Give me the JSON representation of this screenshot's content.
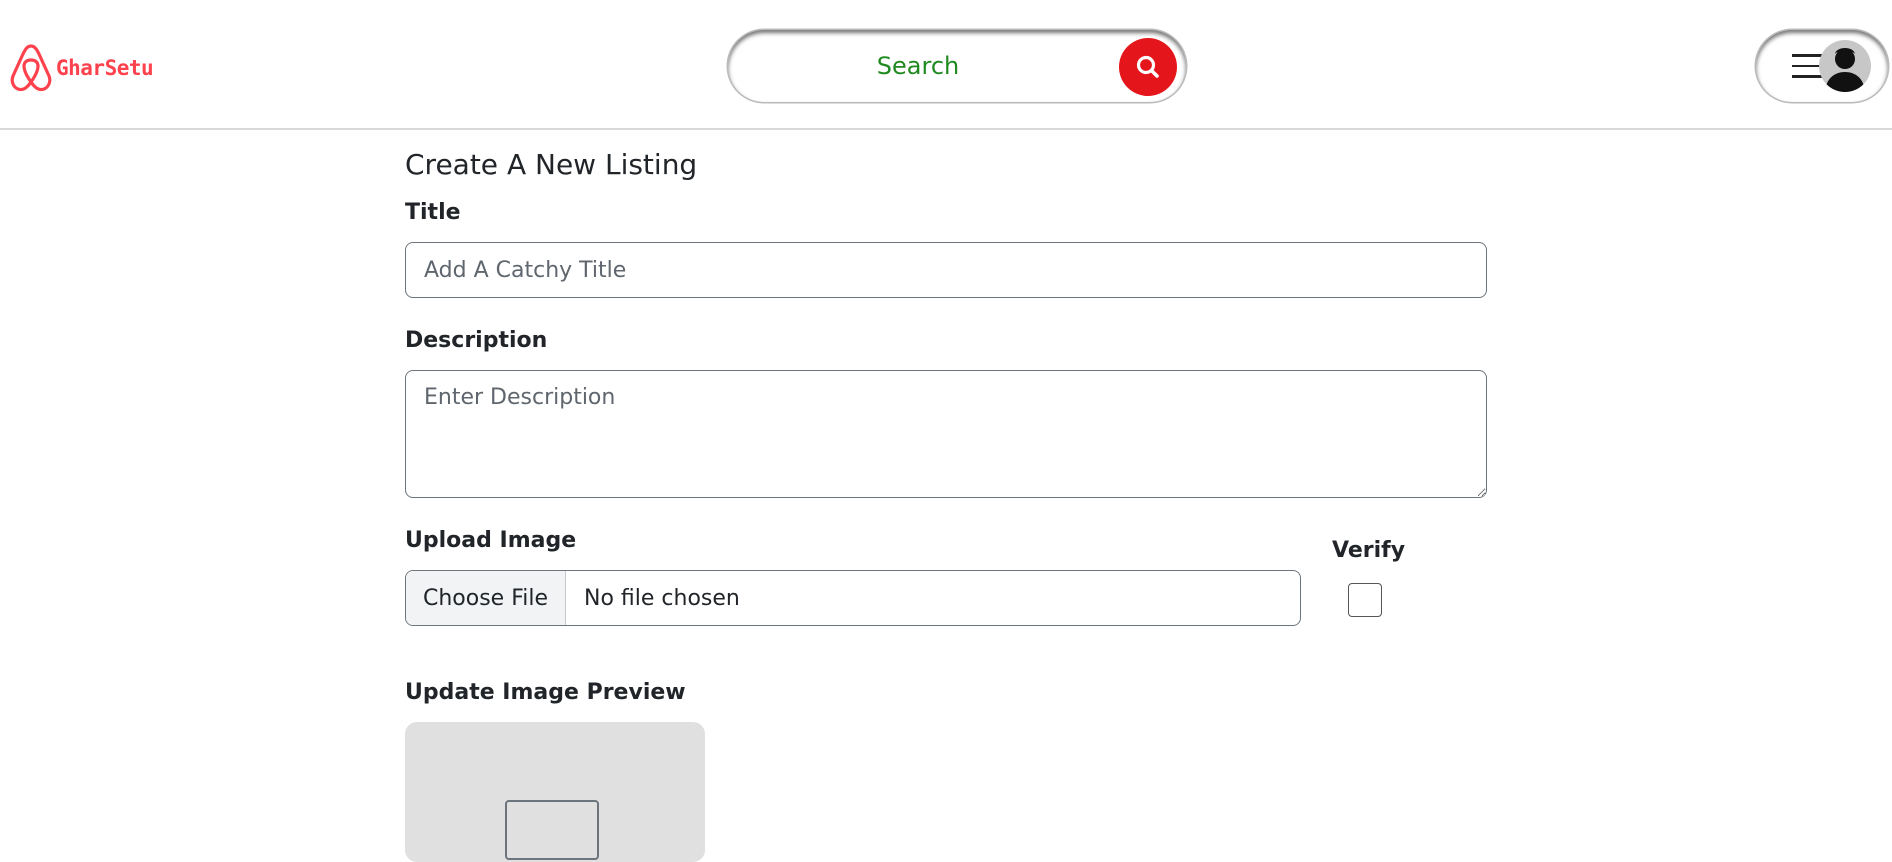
{
  "brand": {
    "name": "GharSetu",
    "logo_icon": "airbnb-style-logo-icon",
    "color": "#fe424d"
  },
  "search": {
    "placeholder": "Search",
    "button_icon": "search-icon",
    "button_color": "#e5161b",
    "text_color": "#1f8a1f"
  },
  "profile": {
    "menu_icon": "hamburger-menu-icon",
    "avatar_icon": "user-avatar-icon"
  },
  "form": {
    "heading": "Create A New Listing",
    "title_label": "Title",
    "title_placeholder": "Add A Catchy Title",
    "description_label": "Description",
    "description_placeholder": "Enter Description",
    "upload_label": "Upload Image",
    "choose_file_label": "Choose File",
    "file_status": "No file chosen",
    "verify_label": "Verify",
    "verify_checked": false,
    "preview_label": "Update Image Preview"
  }
}
